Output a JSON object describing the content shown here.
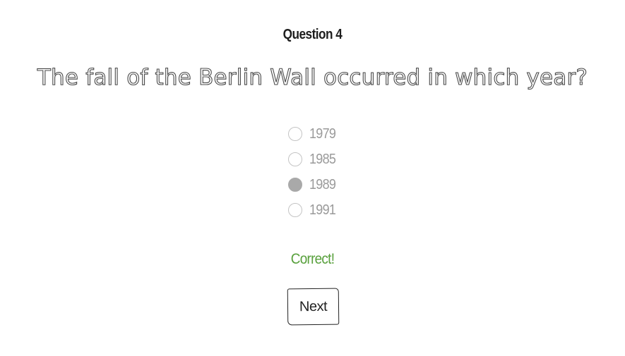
{
  "question": {
    "number_label": "Question 4",
    "text": "The fall of the Berlin Wall occurred in which year?"
  },
  "options": [
    {
      "label": "1979",
      "selected": false
    },
    {
      "label": "1985",
      "selected": false
    },
    {
      "label": "1989",
      "selected": true
    },
    {
      "label": "1991",
      "selected": false
    }
  ],
  "feedback": {
    "text": "Correct!",
    "color": "#58a03c"
  },
  "next_button": {
    "label": "Next"
  }
}
